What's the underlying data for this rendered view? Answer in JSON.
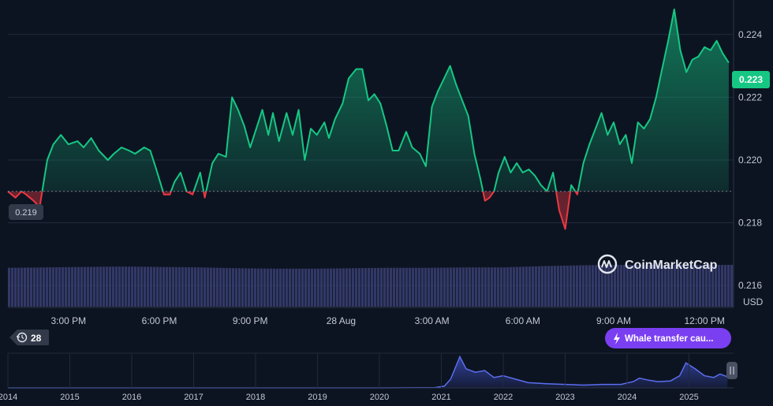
{
  "brand": {
    "name": "CoinMarketCap"
  },
  "currency_label": "USD",
  "price_badge": "0.223",
  "start_badge": "0.219",
  "events_badge": {
    "count": "28"
  },
  "whale_badge": {
    "label": "Whale transfer cau..."
  },
  "colors": {
    "background": "#0d1421",
    "up": "#16c784",
    "down": "#ea3943",
    "volume": "#3a3f73",
    "navigator": "#4a5fd0",
    "badge_purple": "#7b3ff2"
  },
  "chart_data": [
    {
      "type": "area",
      "y_axis": {
        "ticks": [
          "0.224",
          "0.222",
          "0.220",
          "0.218",
          "0.216"
        ],
        "ylim": [
          0.2153,
          0.2251
        ]
      },
      "x_axis": {
        "ticks": [
          "3:00 PM",
          "6:00 PM",
          "9:00 PM",
          "28 Aug",
          "3:00 AM",
          "6:00 AM",
          "9:00 AM",
          "12:00 PM"
        ]
      },
      "baseline": 0.219,
      "last_value": 0.223,
      "x_hours": [
        0,
        0.25,
        0.45,
        0.6,
        0.85,
        1.05,
        1.3,
        1.5,
        1.75,
        2.0,
        2.3,
        2.5,
        2.75,
        3.0,
        3.3,
        3.5,
        3.75,
        4.0,
        4.2,
        4.5,
        4.7,
        4.9,
        5.15,
        5.35,
        5.5,
        5.7,
        5.9,
        6.1,
        6.35,
        6.5,
        6.75,
        6.95,
        7.2,
        7.4,
        7.6,
        7.8,
        8.0,
        8.2,
        8.4,
        8.6,
        8.75,
        8.95,
        9.2,
        9.4,
        9.6,
        9.8,
        10.0,
        10.2,
        10.45,
        10.6,
        10.8,
        11.05,
        11.25,
        11.5,
        11.7,
        11.9,
        12.1,
        12.3,
        12.5,
        12.7,
        12.9,
        13.15,
        13.35,
        13.6,
        13.8,
        14.0,
        14.2,
        14.4,
        14.6,
        14.8,
        15.0,
        15.2,
        15.4,
        15.6,
        15.75,
        15.9,
        16.05,
        16.2,
        16.4,
        16.6,
        16.8,
        17.0,
        17.2,
        17.4,
        17.6,
        17.8,
        18.0,
        18.2,
        18.4,
        18.6,
        18.8,
        19.0,
        19.2,
        19.4,
        19.6,
        19.8,
        20.0,
        20.2,
        20.4,
        20.6,
        20.8,
        21.0,
        21.2,
        21.4,
        21.6,
        21.8,
        22.0,
        22.2,
        22.4,
        22.6,
        22.8,
        23.0,
        23.2,
        23.4,
        23.6,
        23.8
      ],
      "y_values": [
        0.219,
        0.2188,
        0.219,
        0.2189,
        0.2187,
        0.2185,
        0.22,
        0.2205,
        0.2208,
        0.2205,
        0.2206,
        0.2204,
        0.2207,
        0.2203,
        0.22,
        0.2202,
        0.2204,
        0.2203,
        0.2202,
        0.2204,
        0.2203,
        0.2197,
        0.2189,
        0.2189,
        0.2193,
        0.2196,
        0.219,
        0.2189,
        0.2196,
        0.2188,
        0.2199,
        0.2202,
        0.2201,
        0.222,
        0.2216,
        0.2211,
        0.2204,
        0.221,
        0.2216,
        0.2208,
        0.2215,
        0.2206,
        0.2215,
        0.2208,
        0.2216,
        0.22,
        0.221,
        0.2208,
        0.2212,
        0.2207,
        0.2213,
        0.2218,
        0.2226,
        0.2229,
        0.2229,
        0.2219,
        0.2221,
        0.2218,
        0.2211,
        0.2203,
        0.2203,
        0.2209,
        0.2204,
        0.2202,
        0.2198,
        0.2217,
        0.2222,
        0.2226,
        0.223,
        0.2224,
        0.2219,
        0.2214,
        0.2202,
        0.2194,
        0.2187,
        0.2188,
        0.219,
        0.2196,
        0.2201,
        0.2196,
        0.2199,
        0.2196,
        0.2197,
        0.2195,
        0.2192,
        0.219,
        0.2196,
        0.2184,
        0.2178,
        0.2192,
        0.2189,
        0.2199,
        0.2205,
        0.221,
        0.2215,
        0.2208,
        0.2212,
        0.2205,
        0.2208,
        0.2199,
        0.2212,
        0.221,
        0.2213,
        0.222,
        0.2229,
        0.2238,
        0.2248,
        0.2235,
        0.2228,
        0.2232,
        0.2233,
        0.2236,
        0.2235,
        0.2238,
        0.2234,
        0.2231
      ],
      "volume": {
        "relative": [
          0.93,
          0.94,
          0.95,
          0.96,
          0.95,
          0.94,
          0.92,
          0.91,
          0.91,
          0.92,
          0.93,
          0.93,
          0.94,
          0.94,
          0.97,
          0.99,
          1.0,
          1.0,
          1.0,
          1.0
        ]
      }
    },
    {
      "type": "area",
      "x_axis": {
        "ticks": [
          "2014",
          "2015",
          "2016",
          "2017",
          "2018",
          "2019",
          "2020",
          "2021",
          "2022",
          "2023",
          "2024",
          "2025"
        ]
      },
      "x_years": [
        2014.0,
        2015.0,
        2016.0,
        2017.0,
        2018.0,
        2019.0,
        2020.0,
        2020.9,
        2021.05,
        2021.15,
        2021.3,
        2021.4,
        2021.55,
        2021.7,
        2021.85,
        2022.0,
        2022.2,
        2022.4,
        2022.7,
        2023.0,
        2023.3,
        2023.6,
        2023.9,
        2024.1,
        2024.2,
        2024.35,
        2024.5,
        2024.7,
        2024.85,
        2024.95,
        2025.1,
        2025.25,
        2025.4,
        2025.5,
        2025.62
      ],
      "y_rel": [
        0.0,
        0.0,
        0.0,
        0.0,
        0.0,
        0.0,
        0.0,
        0.01,
        0.05,
        0.25,
        0.9,
        0.55,
        0.45,
        0.5,
        0.3,
        0.35,
        0.25,
        0.15,
        0.12,
        0.1,
        0.08,
        0.1,
        0.1,
        0.18,
        0.28,
        0.22,
        0.18,
        0.2,
        0.35,
        0.72,
        0.55,
        0.35,
        0.3,
        0.4,
        0.32
      ]
    }
  ]
}
